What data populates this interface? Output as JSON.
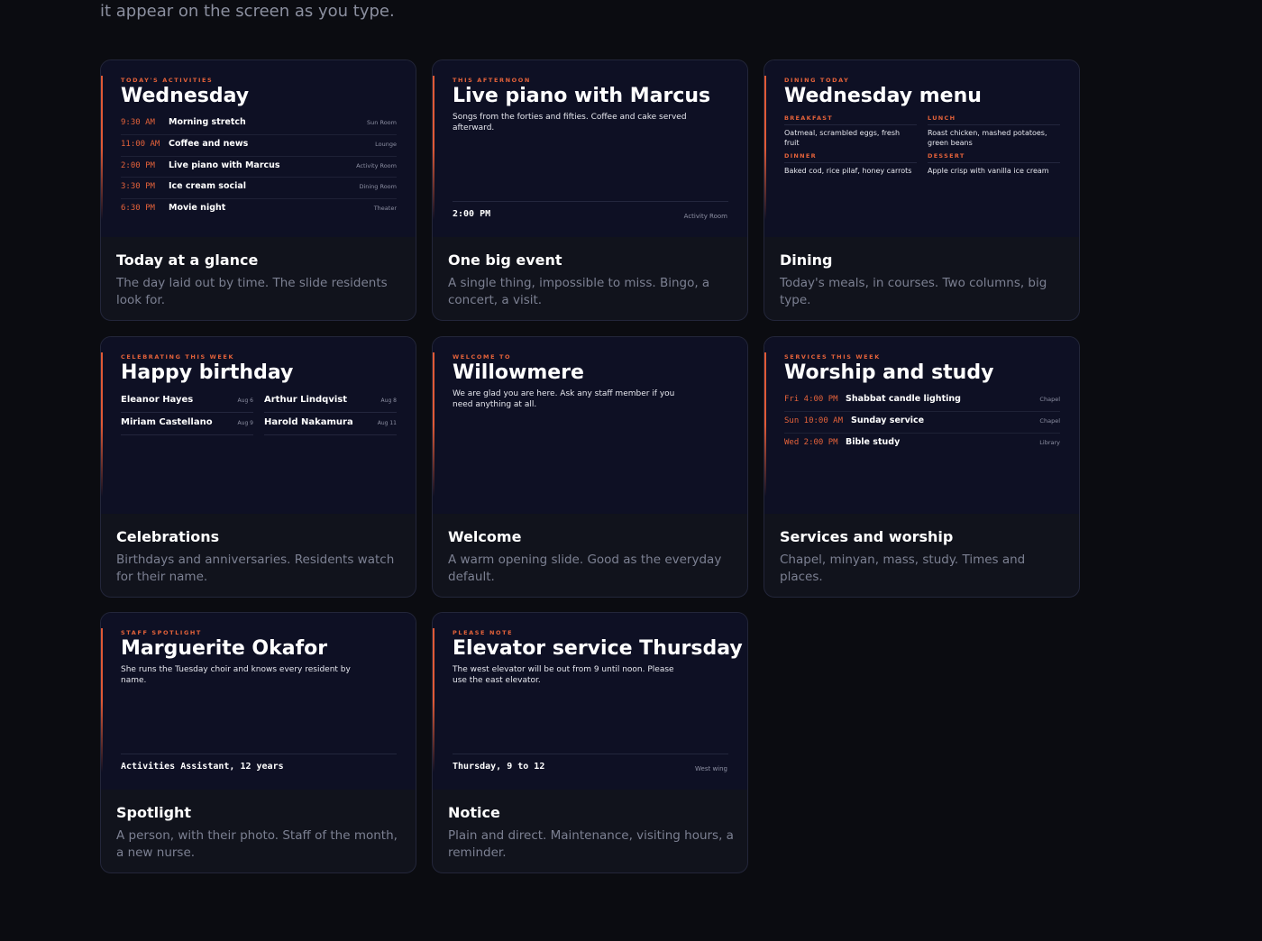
{
  "intro_text": "it appear on the screen as you type.",
  "colors": {
    "background": "#0b0c11",
    "card": "#11131c",
    "preview": "#0e1024",
    "accent": "#e4623a"
  },
  "cards": [
    {
      "title": "Today at a glance",
      "description": "The day laid out by time. The slide residents look for.",
      "slide": {
        "eyebrow": "TODAY'S ACTIVITIES",
        "title": "Wednesday",
        "rows": [
          {
            "time": "9:30 AM",
            "name": "Morning stretch",
            "location": "Sun Room"
          },
          {
            "time": "11:00 AM",
            "name": "Coffee and news",
            "location": "Lounge"
          },
          {
            "time": "2:00 PM",
            "name": "Live piano with Marcus",
            "location": "Activity Room"
          },
          {
            "time": "3:30 PM",
            "name": "Ice cream social",
            "location": "Dining Room"
          },
          {
            "time": "6:30 PM",
            "name": "Movie night",
            "location": "Theater"
          }
        ]
      }
    },
    {
      "title": "One big event",
      "description": "A single thing, impossible to miss. Bingo, a concert, a visit.",
      "slide": {
        "eyebrow": "THIS AFTERNOON",
        "title": "Live piano with Marcus",
        "text": "Songs from the forties and fifties. Coffee and cake served afterward.",
        "footer": "2:00 PM",
        "footer_location": "Activity Room"
      }
    },
    {
      "title": "Dining",
      "description": "Today's meals, in courses. Two columns, big type.",
      "slide": {
        "eyebrow": "DINING TODAY",
        "title": "Wednesday menu",
        "meals": [
          {
            "label": "BREAKFAST",
            "text": "Oatmeal, scrambled eggs, fresh fruit"
          },
          {
            "label": "LUNCH",
            "text": "Roast chicken, mashed potatoes, green beans"
          },
          {
            "label": "DINNER",
            "text": "Baked cod, rice pilaf, honey carrots"
          },
          {
            "label": "DESSERT",
            "text": "Apple crisp with vanilla ice cream"
          }
        ]
      }
    },
    {
      "title": "Celebrations",
      "description": "Birthdays and anniversaries. Residents watch for their name.",
      "slide": {
        "eyebrow": "CELEBRATING THIS WEEK",
        "title": "Happy birthday",
        "people": [
          {
            "name": "Eleanor Hayes",
            "date": "Aug 6"
          },
          {
            "name": "Arthur Lindqvist",
            "date": "Aug 8"
          },
          {
            "name": "Miriam Castellano",
            "date": "Aug 9"
          },
          {
            "name": "Harold Nakamura",
            "date": "Aug 11"
          }
        ]
      }
    },
    {
      "title": "Welcome",
      "description": "A warm opening slide. Good as the everyday default.",
      "slide": {
        "eyebrow": "WELCOME TO",
        "title": "Willowmere",
        "text": "We are glad you are here. Ask any staff member if you need anything at all."
      }
    },
    {
      "title": "Services and worship",
      "description": "Chapel, minyan, mass, study. Times and places.",
      "slide": {
        "eyebrow": "SERVICES THIS WEEK",
        "title": "Worship and study",
        "rows": [
          {
            "time": "Fri 4:00 PM",
            "name": "Shabbat candle lighting",
            "location": "Chapel"
          },
          {
            "time": "Sun 10:00 AM",
            "name": "Sunday service",
            "location": "Chapel"
          },
          {
            "time": "Wed 2:00 PM",
            "name": "Bible study",
            "location": "Library"
          }
        ]
      }
    },
    {
      "title": "Spotlight",
      "description": "A person, with their photo. Staff of the month, a new nurse.",
      "slide": {
        "eyebrow": "STAFF SPOTLIGHT",
        "title": "Marguerite Okafor",
        "text": "She runs the Tuesday choir and knows every resident by name.",
        "footer": "Activities Assistant, 12 years"
      }
    },
    {
      "title": "Notice",
      "description": "Plain and direct. Maintenance, visiting hours, a reminder.",
      "slide": {
        "eyebrow": "PLEASE NOTE",
        "title": "Elevator service Thursday",
        "text": "The west elevator will be out from 9 until noon. Please use the east elevator.",
        "footer": "Thursday, 9 to 12",
        "footer_location": "West wing"
      }
    }
  ]
}
